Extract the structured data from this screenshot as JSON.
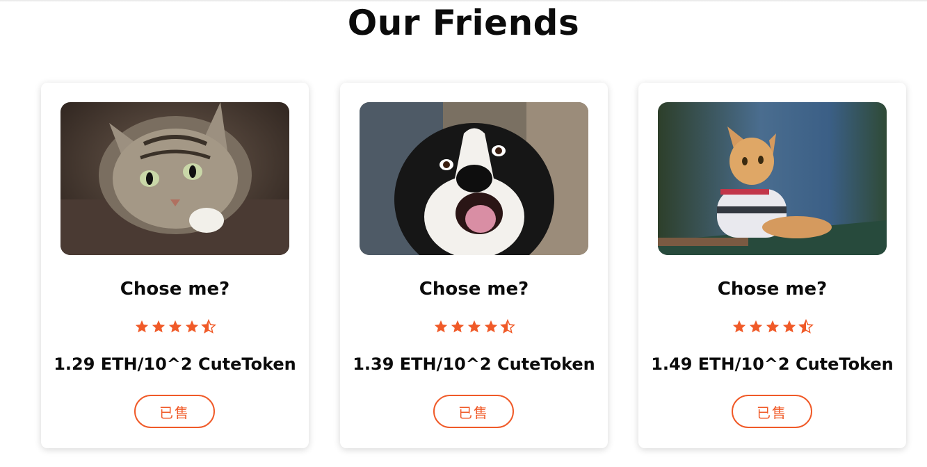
{
  "section": {
    "title": "Our Friends"
  },
  "colors": {
    "accent": "#f05a28",
    "star": "#f05a28"
  },
  "cards": [
    {
      "image": "cat-tabby-photo",
      "name": "Chose me?",
      "rating": 4.5,
      "price": "1.29 ETH/10^2 CuteToken",
      "button_label": "已售"
    },
    {
      "image": "dog-border-collie-photo",
      "name": "Chose me?",
      "rating": 4.5,
      "price": "1.39 ETH/10^2 CuteToken",
      "button_label": "已售"
    },
    {
      "image": "cat-ginger-sweater-photo",
      "name": "Chose me?",
      "rating": 4.5,
      "price": "1.49 ETH/10^2 CuteToken",
      "button_label": "已售"
    }
  ]
}
